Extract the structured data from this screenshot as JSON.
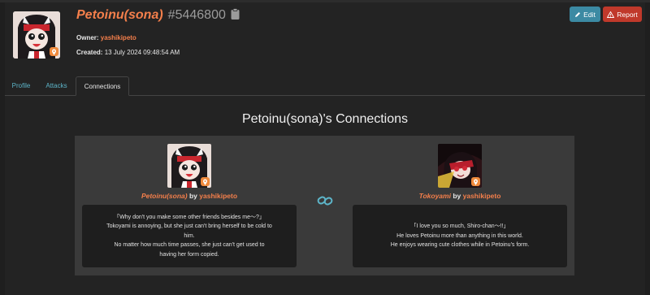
{
  "character": {
    "name": "Petoinu(sona)",
    "id": "#5446800",
    "owner_label": "Owner:",
    "owner": "yashikipeto",
    "created_label": "Created:",
    "created": "13 July 2024 09:48:54 AM"
  },
  "actions": {
    "edit_label": "Edit",
    "report_label": "Report"
  },
  "tabs": [
    {
      "label": "Profile",
      "active": false
    },
    {
      "label": "Attacks",
      "active": false
    },
    {
      "label": "Connections",
      "active": true
    }
  ],
  "connections": {
    "heading": "Petoinu(sona)'s Connections",
    "left": {
      "name": "Petoinu(sona)",
      "by": "by",
      "owner": "yashikipeto",
      "lines": [
        "「Why don't you make some other friends besides me〜?」",
        "Tokoyami is annoying, but she just can't bring herself to be cold to",
        "him.",
        "No matter how much time passes, she just can't get used to",
        "having her form copied."
      ]
    },
    "right": {
      "name": "Tokoyami",
      "by": "by",
      "owner": "yashikipeto",
      "lines": [
        "「I love you so much, Shiro-chan〜!!」",
        "He loves Petoinu more than anything in this world.",
        "He enjoys wearing cute clothes while in Petoinu's form."
      ]
    }
  },
  "colors": {
    "accent": "#f47f4b",
    "tab_link": "#5db5c9",
    "edit_button": "#3c8aa3",
    "report_button": "#c0392b",
    "panel": "#3a3a3a",
    "background": "#1f1f1f"
  },
  "icons": {
    "clipboard": "clipboard-icon",
    "edit": "pencil-icon",
    "report": "warning-icon",
    "link": "chain-link-icon",
    "badge": "pin-badge-icon"
  }
}
